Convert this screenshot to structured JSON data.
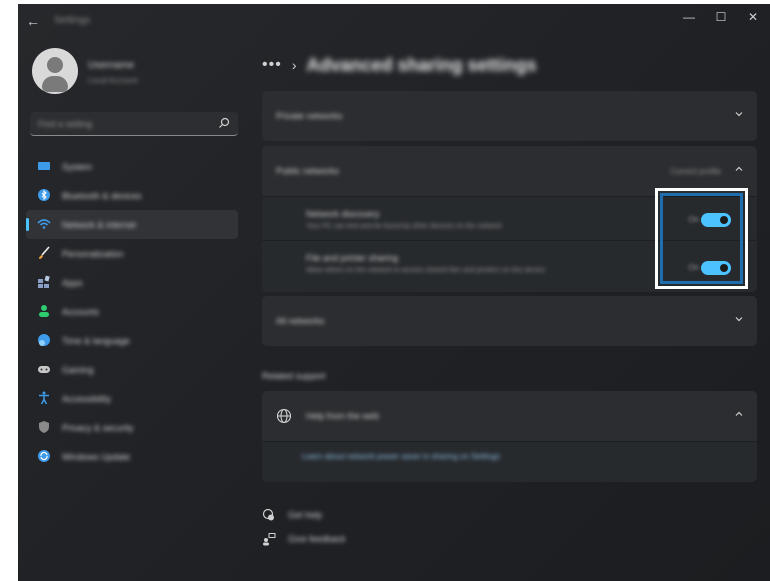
{
  "window": {
    "app_title": "Settings",
    "controls": {
      "minimize": "—",
      "maximize": "☐",
      "close": "✕"
    }
  },
  "profile": {
    "name": "Username",
    "email": "Local Account"
  },
  "search": {
    "placeholder": "Find a setting"
  },
  "sidebar": {
    "items": [
      {
        "label": "System",
        "icon": "monitor-icon",
        "color": "#3d9be9"
      },
      {
        "label": "Bluetooth & devices",
        "icon": "bluetooth-icon",
        "color": "#3d9be9"
      },
      {
        "label": "Network & internet",
        "icon": "wifi-icon",
        "color": "#3d9be9",
        "active": true
      },
      {
        "label": "Personalization",
        "icon": "brush-icon",
        "color": "#e8a03a"
      },
      {
        "label": "Apps",
        "icon": "apps-icon",
        "color": "#8aa0c8"
      },
      {
        "label": "Accounts",
        "icon": "person-icon",
        "color": "#2ecc71"
      },
      {
        "label": "Time & language",
        "icon": "globe-clock-icon",
        "color": "#3d9be9"
      },
      {
        "label": "Gaming",
        "icon": "gamepad-icon",
        "color": "#c8c8c8"
      },
      {
        "label": "Accessibility",
        "icon": "accessibility-icon",
        "color": "#3d9be9"
      },
      {
        "label": "Privacy & security",
        "icon": "shield-icon",
        "color": "#8a8a8a"
      },
      {
        "label": "Windows Update",
        "icon": "update-icon",
        "color": "#3d9be9"
      }
    ]
  },
  "main": {
    "breadcrumb_more": "•••",
    "breadcrumb_sep": "›",
    "title": "Advanced sharing settings",
    "private_networks": {
      "title": "Private networks"
    },
    "public_networks": {
      "title": "Public networks",
      "meta": "Current profile",
      "settings": [
        {
          "title": "Network discovery",
          "desc": "Your PC can find and be found by other devices on the network",
          "state": "On"
        },
        {
          "title": "File and printer sharing",
          "desc": "Allow others on the network to access shared files and printers on this device",
          "state": "On"
        }
      ]
    },
    "all_networks": {
      "title": "All networks"
    },
    "related_support": {
      "heading": "Related support",
      "help_title": "Help from the web",
      "help_link": "Learn about network power saver in sharing on Settings"
    },
    "footer": {
      "get_help": "Get help",
      "give_feedback": "Give feedback"
    }
  },
  "colors": {
    "accent": "#4cc2ff",
    "highlight_outer": "#ffffff",
    "highlight_inner": "#1f6fb0"
  }
}
